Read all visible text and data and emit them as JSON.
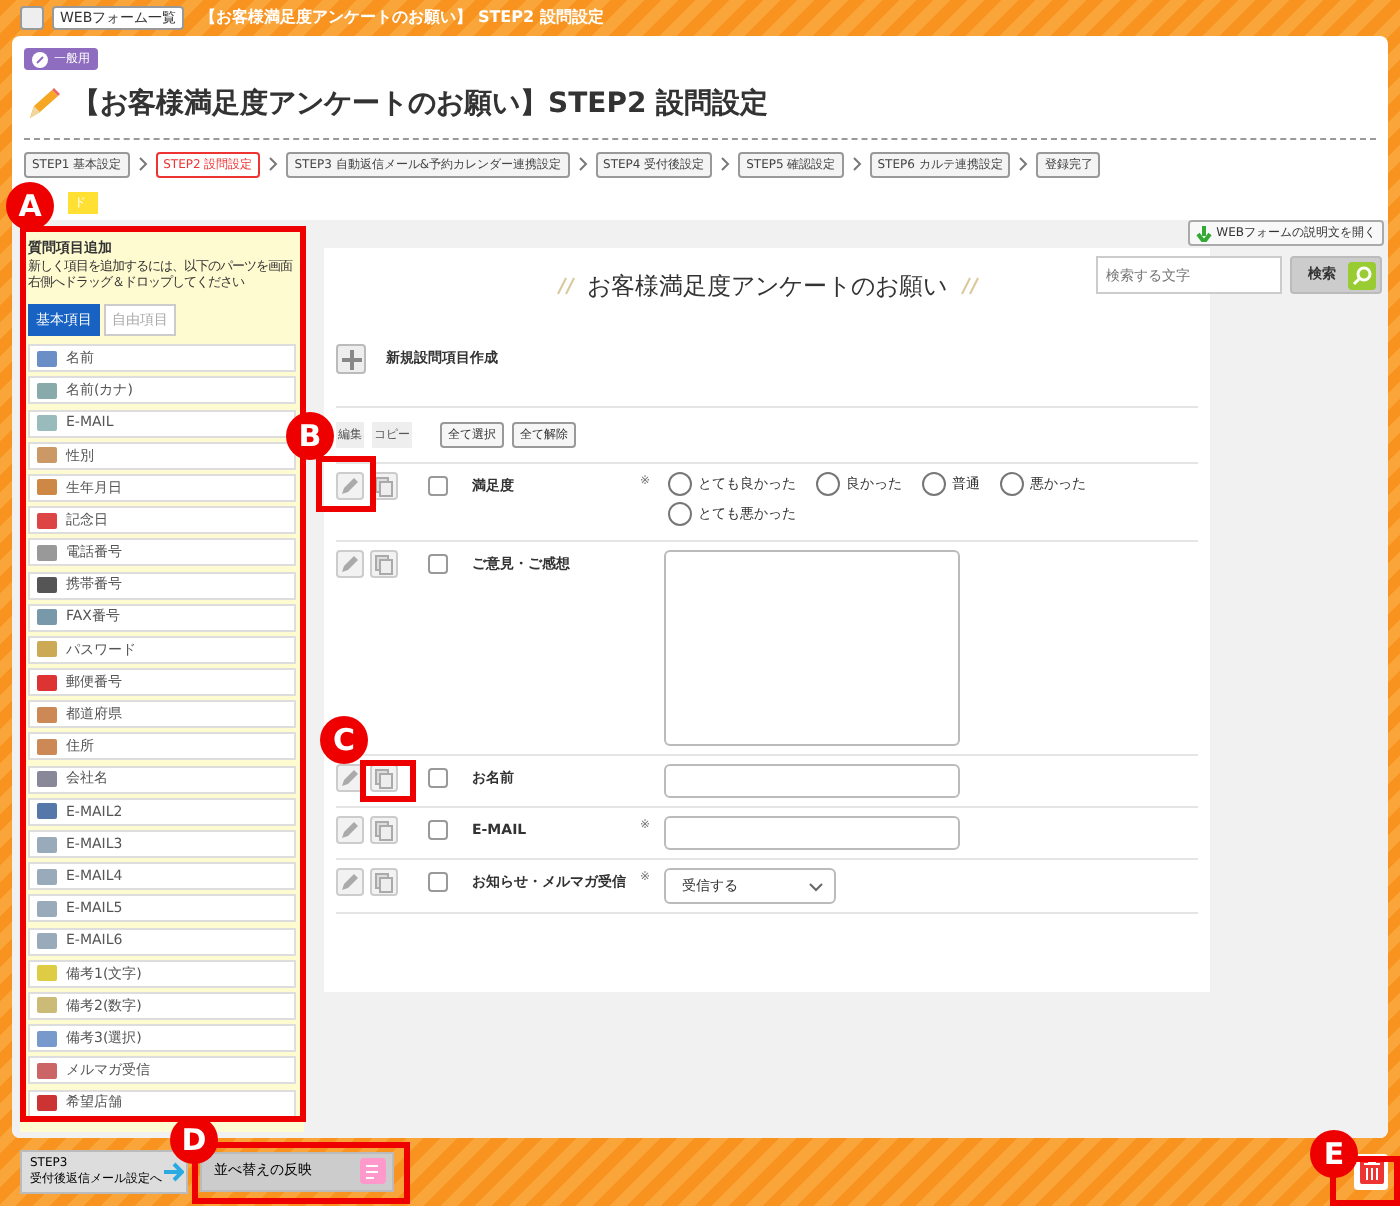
{
  "breadcrumb": [
    {
      "label": "WEBフォーム一覧"
    },
    {
      "label": "【お客様満足度アンケートのお願い】 STEP2 設問設定"
    }
  ],
  "badge": "一般用",
  "page_title": "【お客様満足度アンケートのお願い】STEP2 設問設定",
  "steps": [
    {
      "label": "STEP1 基本設定",
      "selected": false
    },
    {
      "label": "STEP2 設問設定",
      "selected": true
    },
    {
      "label": "STEP3 自動返信メール&予約カレンダー連携設定",
      "selected": false
    },
    {
      "label": "STEP4 受付後設定",
      "selected": false
    },
    {
      "label": "STEP5 確認設定",
      "selected": false
    },
    {
      "label": "STEP6 カルテ連携設定",
      "selected": false
    },
    {
      "label": "登録完了",
      "selected": false
    }
  ],
  "guide_button": "ド",
  "sidebar": {
    "title": "質問項目追加",
    "description": "新しく項目を追加するには、以下のパーツを画面右側へドラッグ＆ドロップしてください",
    "tabs": [
      {
        "label": "基本項目",
        "selected": true
      },
      {
        "label": "自由項目",
        "selected": false
      }
    ],
    "items": [
      {
        "label": "名前"
      },
      {
        "label": "名前(カナ)"
      },
      {
        "label": "E-MAIL"
      },
      {
        "label": "性別"
      },
      {
        "label": "生年月日"
      },
      {
        "label": "記念日"
      },
      {
        "label": "電話番号"
      },
      {
        "label": "携帯番号"
      },
      {
        "label": "FAX番号"
      },
      {
        "label": "パスワード"
      },
      {
        "label": "郵便番号"
      },
      {
        "label": "都道府県"
      },
      {
        "label": "住所"
      },
      {
        "label": "会社名"
      },
      {
        "label": "E-MAIL2"
      },
      {
        "label": "E-MAIL3"
      },
      {
        "label": "E-MAIL4"
      },
      {
        "label": "E-MAIL5"
      },
      {
        "label": "E-MAIL6"
      },
      {
        "label": "備考1(文字)"
      },
      {
        "label": "備考2(数字)"
      },
      {
        "label": "備考3(選択)"
      },
      {
        "label": "メルマガ受信"
      },
      {
        "label": "希望店舗"
      }
    ]
  },
  "description_button": "WEBフォームの説明文を開く",
  "search": {
    "placeholder": "検索する文字",
    "button": "検索"
  },
  "form_title": "お客様満足度アンケートのお願い",
  "new_item": "新規設問項目作成",
  "list_header": {
    "columns": [
      "編集",
      "コピー"
    ],
    "buttons": [
      "全て選択",
      "全て解除"
    ]
  },
  "questions": [
    {
      "kind": "radio",
      "label": "満足度",
      "required_mark": "※",
      "checked": false,
      "options": [
        {
          "label": "とても良かった",
          "selected": false
        },
        {
          "label": "良かった",
          "selected": false
        },
        {
          "label": "普通",
          "selected": false
        },
        {
          "label": "悪かった",
          "selected": false
        },
        {
          "label": "とても悪かった",
          "selected": false
        }
      ]
    },
    {
      "kind": "textarea",
      "label": "ご意見・ご感想",
      "checked": false
    },
    {
      "kind": "text",
      "label": "お名前",
      "checked": false
    },
    {
      "kind": "text",
      "label": "E-MAIL",
      "required_mark": "※",
      "checked": false
    },
    {
      "kind": "select",
      "label": "お知らせ・メルマガ受信",
      "required_mark": "※",
      "checked": false,
      "value": "受信する"
    }
  ],
  "footer": {
    "next_step": "STEP3",
    "next_label": "受付後返信メール設定へ",
    "apply_button": "並べ替えの反映"
  },
  "annotations": [
    "A",
    "B",
    "C",
    "D",
    "E"
  ]
}
